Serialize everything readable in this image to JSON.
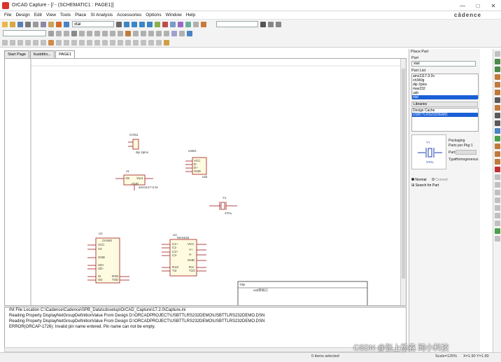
{
  "window": {
    "title": "OrCAD Capture - [/ - (SCHEMATIC1 : PAGE1)]",
    "brand": "cādence",
    "controls": [
      "—",
      "□",
      "✕"
    ]
  },
  "menu": [
    "File",
    "Design",
    "Edit",
    "View",
    "Tools",
    "Place",
    "SI Analysis",
    "Accessories",
    "Options",
    "Window",
    "Help"
  ],
  "toolbar": {
    "search_value": "xtal",
    "combo_value": ""
  },
  "tabs": [
    "Start Page",
    "ltusbttlrs...",
    "PAGE1"
  ],
  "schematic": {
    "parts": [
      {
        "ref": "CON1",
        "value": "dip 2pins"
      },
      {
        "ref": "USB1",
        "value": "usb",
        "pins": [
          "VCC",
          "D-",
          "D+",
          "GND"
        ]
      },
      {
        "ref": "J1",
        "value": "ams1117-3.3v",
        "pins": [
          "Vin",
          "Vout",
          "GND"
        ]
      },
      {
        "ref": "Y1",
        "value": "XTAL"
      },
      {
        "ref": "U1",
        "value": "CH340",
        "pins": [
          "VCC",
          "V3",
          "GND",
          "UD+",
          "UD-",
          "XI",
          "XO",
          "RXD",
          "TXD"
        ]
      },
      {
        "ref": "U2",
        "value": "MAX232",
        "pins": [
          "C1+",
          "C1-",
          "C2+",
          "C2-",
          "VCC",
          "V+",
          "V-",
          "GND",
          "R1O",
          "T1I",
          "R1I",
          "T1O"
        ]
      }
    ],
    "title_block": {
      "label": "Title",
      "value": "usb转串口"
    }
  },
  "log": [
    "INI File Location C:\\Cadence\\Cadence\\SPB_Data\\cdssetup\\OrCAD_Capture\\17.2.0\\Capture.ini",
    "Reading Property DisplayNetGroupDefinitionValue From Design D:\\ORCADPROJECT\\USBTTLRS232DEMO\\USBTTLRS232DEMO.DSN",
    "Reading Property DisplayNetGroupDefinitionValue From Design D:\\ORCADPROJECT\\USBTTLRS232DEMO\\USBTTLRS232DEMO.DSN",
    "ERROR(ORCAP-1726): Invalid pin name entered. Pin name can not be empty."
  ],
  "status": {
    "items_selected": "0 items selected",
    "scale": "Scale=125%",
    "coords": "X=1.90  Y=1.90"
  },
  "place_part": {
    "title": "Place Part",
    "part_label": "Part",
    "part_value": "xtal",
    "part_list_label": "Part List",
    "parts": [
      "ams1117-3.3v",
      "ch340g",
      "dip 2pins",
      "max232",
      "usb",
      "xtal"
    ],
    "selected_part": "xtal",
    "libraries_label": "Libraries",
    "libraries": [
      "Design Cache",
      "USBTTLRS232DEMO"
    ],
    "selected_library": "USBTTLRS232DEMO",
    "packaging_label": "Packaging",
    "parts_per_pkg_label": "Parts per Pkg:",
    "parts_per_pkg": "1",
    "part_field_label": "Part:",
    "type_label": "Type:",
    "type_value": "Homogeneous",
    "preview_ref": "Y?",
    "preview_value": "XTAL",
    "normal_label": "Normal",
    "convert_label": "Convert",
    "search_label": "Search for Part"
  },
  "watermark": "CSDN @张上杨鑫 跨小科技"
}
